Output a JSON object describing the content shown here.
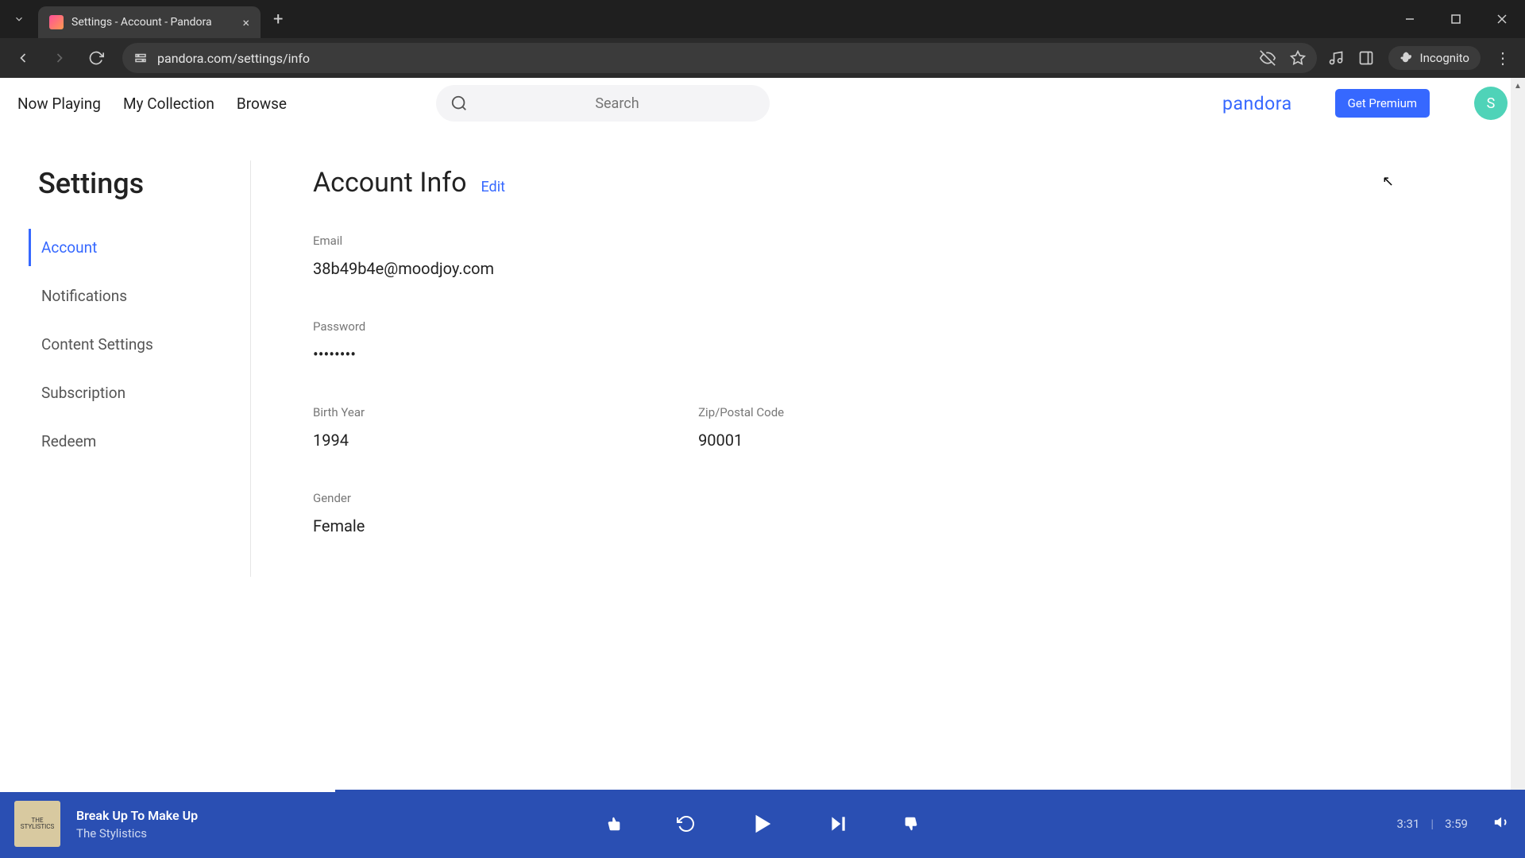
{
  "browser": {
    "tab_title": "Settings - Account - Pandora",
    "url": "pandora.com/settings/info",
    "incognito_label": "Incognito"
  },
  "header": {
    "nav": [
      "Now Playing",
      "My Collection",
      "Browse"
    ],
    "search_placeholder": "Search",
    "brand": "pandora",
    "premium_button": "Get Premium",
    "avatar_initial": "S"
  },
  "sidebar": {
    "title": "Settings",
    "items": [
      {
        "label": "Account",
        "active": true
      },
      {
        "label": "Notifications",
        "active": false
      },
      {
        "label": "Content Settings",
        "active": false
      },
      {
        "label": "Subscription",
        "active": false
      },
      {
        "label": "Redeem",
        "active": false
      }
    ]
  },
  "main": {
    "title": "Account Info",
    "edit_label": "Edit",
    "fields": {
      "email_label": "Email",
      "email_value": "38b49b4e@moodjoy.com",
      "password_label": "Password",
      "password_value": "••••••••",
      "birthyear_label": "Birth Year",
      "birthyear_value": "1994",
      "zip_label": "Zip/Postal Code",
      "zip_value": "90001",
      "gender_label": "Gender",
      "gender_value": "Female"
    }
  },
  "player": {
    "track_title": "Break Up To Make Up",
    "track_artist": "The Stylistics",
    "time_current": "3:31",
    "time_total": "3:59",
    "progress_percent": 22
  }
}
